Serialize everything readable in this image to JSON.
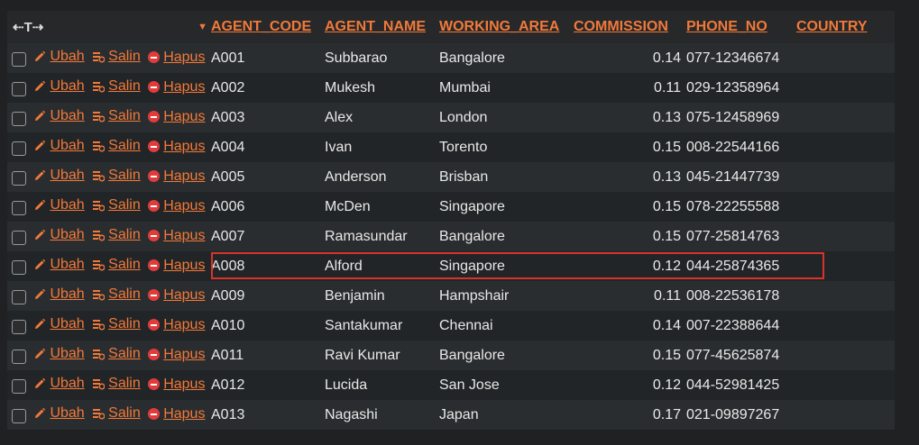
{
  "header": {
    "toolbar_glyph": "⇠T⇢",
    "sort_indicator": "▼",
    "columns": [
      "AGENT_CODE",
      "AGENT_NAME",
      "WORKING_AREA",
      "COMMISSION",
      "PHONE_NO",
      "COUNTRY"
    ]
  },
  "actions": {
    "edit": "Ubah",
    "copy": "Salin",
    "delete": "Hapus"
  },
  "rows": [
    {
      "code": "A001",
      "name": "Subbarao",
      "area": "Bangalore",
      "commission": "0.14",
      "phone": "077-12346674",
      "country": ""
    },
    {
      "code": "A002",
      "name": "Mukesh",
      "area": "Mumbai",
      "commission": "0.11",
      "phone": "029-12358964",
      "country": ""
    },
    {
      "code": "A003",
      "name": "Alex",
      "area": "London",
      "commission": "0.13",
      "phone": "075-12458969",
      "country": ""
    },
    {
      "code": "A004",
      "name": "Ivan",
      "area": "Torento",
      "commission": "0.15",
      "phone": "008-22544166",
      "country": ""
    },
    {
      "code": "A005",
      "name": "Anderson",
      "area": "Brisban",
      "commission": "0.13",
      "phone": "045-21447739",
      "country": ""
    },
    {
      "code": "A006",
      "name": "McDen",
      "area": "Singapore",
      "commission": "0.15",
      "phone": "078-22255588",
      "country": ""
    },
    {
      "code": "A007",
      "name": "Ramasundar",
      "area": "Bangalore",
      "commission": "0.15",
      "phone": "077-25814763",
      "country": ""
    },
    {
      "code": "A008",
      "name": "Alford",
      "area": "Singapore",
      "commission": "0.12",
      "phone": "044-25874365",
      "country": ""
    },
    {
      "code": "A009",
      "name": "Benjamin",
      "area": "Hampshair",
      "commission": "0.11",
      "phone": "008-22536178",
      "country": ""
    },
    {
      "code": "A010",
      "name": "Santakumar",
      "area": "Chennai",
      "commission": "0.14",
      "phone": "007-22388644",
      "country": ""
    },
    {
      "code": "A011",
      "name": "Ravi Kumar",
      "area": "Bangalore",
      "commission": "0.15",
      "phone": "077-45625874",
      "country": ""
    },
    {
      "code": "A012",
      "name": "Lucida",
      "area": "San Jose",
      "commission": "0.12",
      "phone": "044-52981425",
      "country": ""
    },
    {
      "code": "A013",
      "name": "Nagashi",
      "area": "Japan",
      "commission": "0.17",
      "phone": "021-09897267",
      "country": ""
    }
  ],
  "colors": {
    "accent": "#f2793a",
    "highlight": "#d8332b",
    "delete": "#e23b3b"
  }
}
